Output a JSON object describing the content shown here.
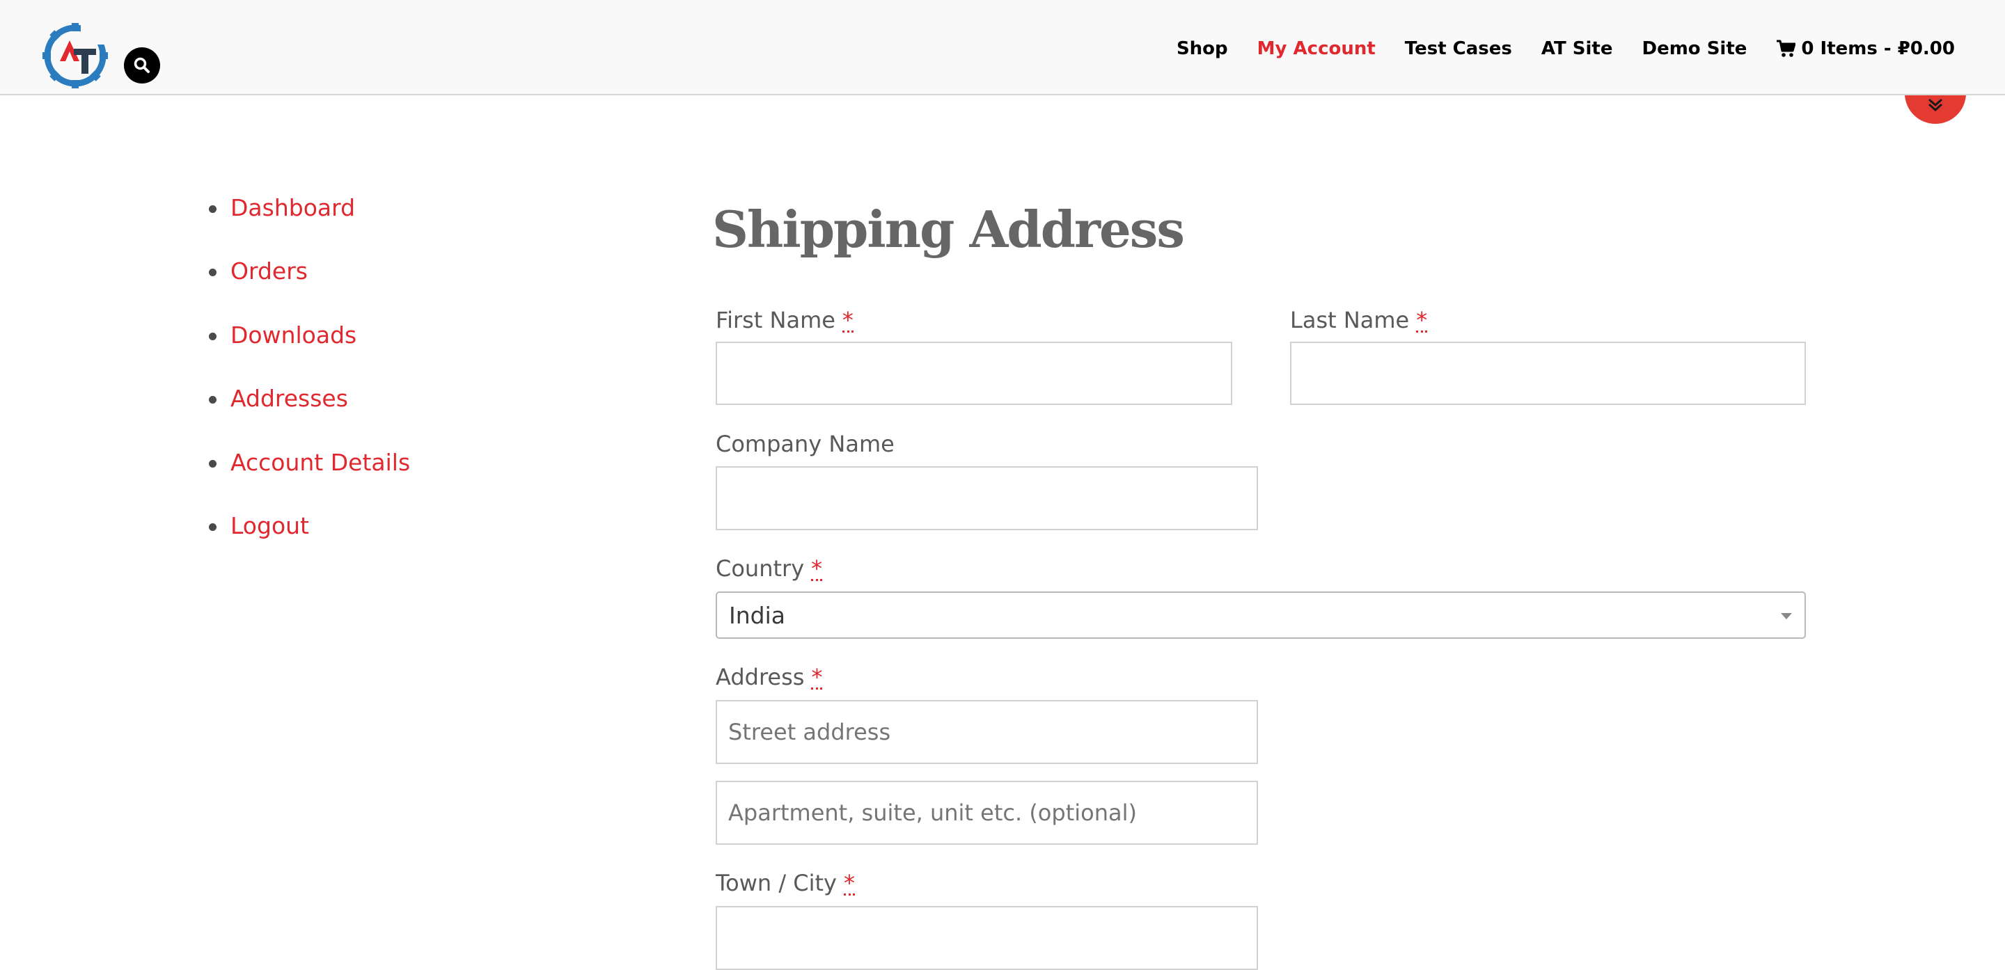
{
  "header": {
    "logo": {
      "letters": "AT",
      "colors": {
        "gear": "#2b7bbf",
        "a": "#e0282e",
        "t": "#2c3e50"
      }
    },
    "search_icon": "search-icon",
    "nav": [
      {
        "label": "Shop",
        "active": false
      },
      {
        "label": "My Account",
        "active": true
      },
      {
        "label": "Test Cases",
        "active": false
      },
      {
        "label": "AT Site",
        "active": false
      },
      {
        "label": "Demo Site",
        "active": false
      }
    ],
    "cart_label": "0 Items - ₽0.00",
    "cart_icon": "cart-icon",
    "scroll_toggle_icon": "chevron-double-down-icon"
  },
  "sidebar": {
    "items": [
      {
        "label": "Dashboard"
      },
      {
        "label": "Orders"
      },
      {
        "label": "Downloads"
      },
      {
        "label": "Addresses"
      },
      {
        "label": "Account Details"
      },
      {
        "label": "Logout"
      }
    ]
  },
  "main": {
    "title": "Shipping Address",
    "required_marker": "*",
    "fields": {
      "first_name": {
        "label": "First Name",
        "value": ""
      },
      "last_name": {
        "label": "Last Name",
        "value": ""
      },
      "company": {
        "label": "Company Name",
        "value": ""
      },
      "country": {
        "label": "Country",
        "value": "India"
      },
      "address": {
        "label": "Address",
        "street_placeholder": "Street address",
        "apartment_placeholder": "Apartment, suite, unit etc. (optional)"
      },
      "city": {
        "label": "Town / City",
        "value": ""
      }
    }
  },
  "colors": {
    "accent": "#e0282e",
    "header_bg": "#f9f9f9",
    "heading": "#666666",
    "label": "#595959"
  }
}
